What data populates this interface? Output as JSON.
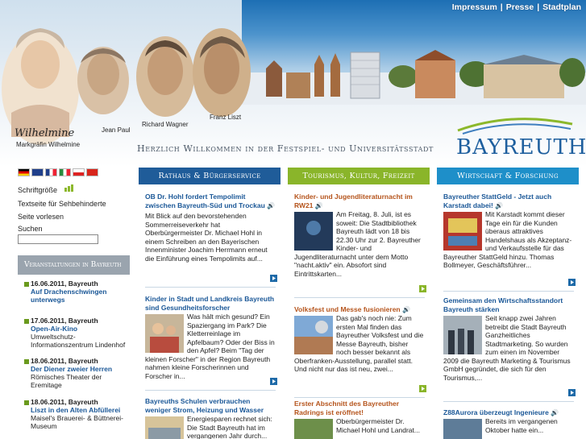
{
  "topnav": {
    "impressum": "Impressum",
    "presse": "Presse",
    "stadtplan": "Stadtplan",
    "sep": "|"
  },
  "header": {
    "welcome": "Herzlich Willkommen in der Festspiel- und Universitätsstadt",
    "logo": "BAYREUTH",
    "portraits": {
      "p1_sig": "Wilhelmine",
      "p1_label": "Markgräfin Wilhelmine",
      "p2_label": "Jean Paul",
      "p3_label": "Richard Wagner",
      "p4_label": "Franz Liszt"
    }
  },
  "sidebar": {
    "font_size_label": "Schriftgröße",
    "text_impaired": "Textseite für Sehbehinderte",
    "read_aloud": "Seite vorlesen",
    "search_label": "Suchen",
    "events_heading": "Veranstaltungen in Bayreuth",
    "events": [
      {
        "date": "16.06.2011, Bayreuth",
        "title": "Auf Drachenschwingen unterwegs",
        "desc": ""
      },
      {
        "date": "17.06.2011, Bayreuth",
        "title": "Open-Air-Kino",
        "desc": "Umweltschutz-Informationszentrum Lindenhof"
      },
      {
        "date": "18.06.2011, Bayreuth",
        "title": "Der Diener zweier Herren",
        "desc": "Römisches Theater der Eremitage"
      },
      {
        "date": "18.06.2011, Bayreuth",
        "title": "Liszt in den Alten Abfüllerei",
        "desc": "Maisel's Brauerei- & Büttnerei-Museum"
      }
    ]
  },
  "columns": {
    "rathaus": {
      "heading": "Rathaus & Bürgerservice",
      "color": "#1f5c99",
      "articles": [
        {
          "title": "OB Dr. Hohl fordert Tempolimit zwischen Bayreuth-Süd und Trockau",
          "text": "Mit Blick auf den bevorstehenden Sommerreiseverkehr hat Oberbürgermeister Dr. Michael Hohl in einem Schreiben an den Bayerischen Innenminister Joachim Herrmann erneut die Einführung eines Tempolimits auf..."
        },
        {
          "title": "Kinder in Stadt und Landkreis Bayreuth sind Gesundheitsforscher",
          "text": "Was hält mich gesund? Ein Spaziergang im Park? Die Kletterreinlage im Apfelbaum? Oder der Biss in den Apfel? Beim \"Tag der kleinen Forscher\" in der Region Bayreuth nahmen kleine Forscherinnen und Forscher in..."
        },
        {
          "title": "Bayreuths Schulen verbrauchen weniger Strom, Heizung und Wasser",
          "text": "Energiesparen rechnet sich: Die Stadt Bayreuth hat im vergangenen Jahr durch..."
        }
      ]
    },
    "tourismus": {
      "heading": "Tourismus, Kultur, Freizeit",
      "color": "#8ab52a",
      "articles": [
        {
          "title": "Kinder- und Jugendliteraturnacht im RW21",
          "text": "Am Freitag, 8. Juli, ist es soweit: Die Stadtbibliothek Bayreuth lädt von 18 bis 22.30 Uhr zur 2. Bayreuther Kinder- und Jugendliteraturnacht unter dem Motto \"nacht.aktiv\" ein. Absofort sind Eintrittskarten..."
        },
        {
          "title": "Volksfest und Messe fusionieren",
          "text": "Das gab's noch nie: Zum ersten Mal finden das Bayreuther Volksfest und die Messe Bayreuth, bisher noch besser bekannt als Oberfranken-Ausstellung, parallel statt. Und nicht nur das ist neu, zwei..."
        },
        {
          "title": "Erster Abschnitt des Bayreuther Radrings ist eröffnet!",
          "text": "Oberbürgermeister Dr. Michael Hohl und Landrat..."
        }
      ]
    },
    "wirtschaft": {
      "heading": "Wirtschaft & Forschung",
      "color": "#1e8fc9",
      "articles": [
        {
          "title": "Bayreuther StattGeld - Jetzt auch Karstadt dabei!",
          "text": "Mit Karstadt kommt dieser Tage ein für die Kunden überaus attraktives Handelshaus als Akzeptanz- und Verkaufsstelle für das Bayreuther StattGeld hinzu. Thomas Bollmeyer, Geschäftsführer..."
        },
        {
          "title": "Gemeinsam den Wirtschaftsstandort Bayreuth stärken",
          "text": "Seit knapp zwei Jahren betreibt die Stadt Bayreuth Ganzheitliches Stadtmarketing. So wurden zum einen im November 2009 die Bayreuth Marketing & Tourismus GmbH gegründet, die sich für den Tourismus,..."
        },
        {
          "title": "Z88Aurora überzeugt Ingenieure",
          "text": "Bereits im vergangenen Oktober hatte ein..."
        }
      ]
    }
  },
  "colors": {
    "more_arrow": "#1e6aa8",
    "event_bullet": "#6a9a1d",
    "link_blue": "#1a5797"
  },
  "icons": {
    "speaker": "speaker-icon",
    "more": "more-arrow-icon"
  }
}
